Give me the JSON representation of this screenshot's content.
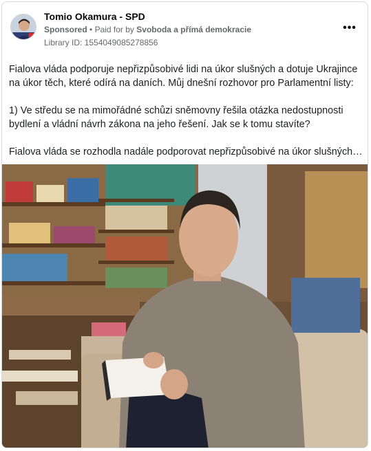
{
  "post": {
    "page_name": "Tomio Okamura - SPD",
    "sponsored": "Sponsored",
    "paid_for_prefix": "Paid for by",
    "payer": "Svoboda a přímá demokracie",
    "library_id": "Library ID: 1554049085278856",
    "more_label": "•••",
    "paragraphs": [
      "Fialova vláda podporuje nepřizpůsobivé lidi na úkor slušných a dotuje Ukrajince na úkor těch, které odírá na daních. Můj dnešní rozhovor pro Parlamentní listy:",
      "1) Ve středu se na mimořádné schůzi sněmovny řešila otázka nedostupnosti bydlení a vládní návrh zákona na jeho řešení. Jak se k tomu stavíte?",
      "Fialova vláda se rozhodla nadále podporovat nepřizpůsobivé na úkor slušných lidí…"
    ]
  },
  "colors": {
    "text_primary": "#050505",
    "text_secondary": "#65676b",
    "border": "#d8dadf"
  },
  "icons": {
    "avatar": "profile-photo",
    "more": "more-horizontal-icon"
  }
}
